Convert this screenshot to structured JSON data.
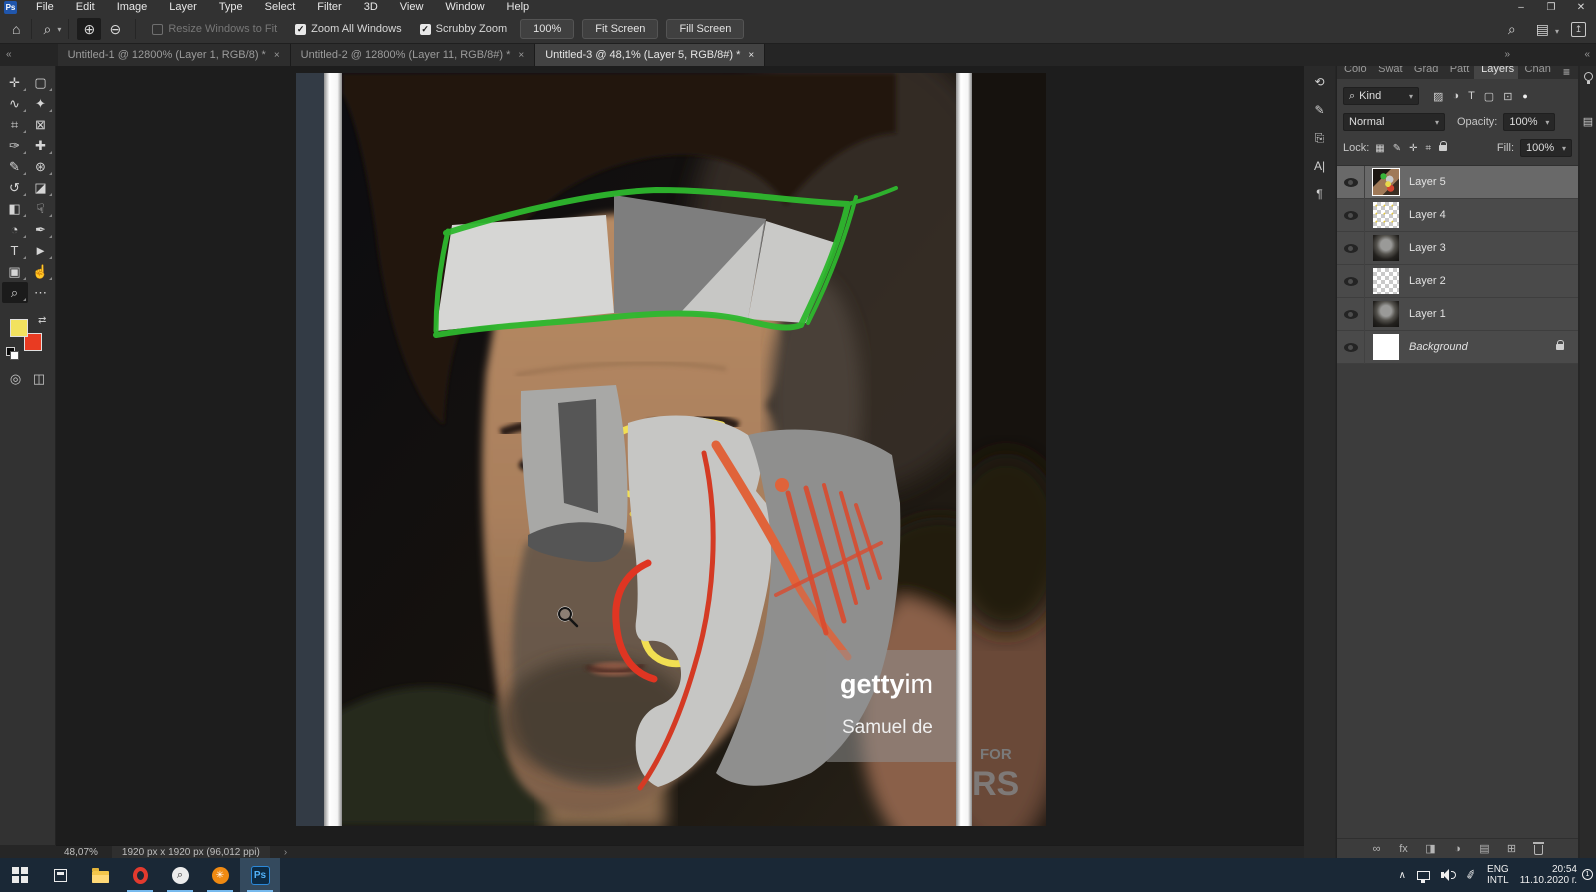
{
  "app": {
    "logo": "Ps",
    "window_controls": {
      "minimize": "–",
      "restore": "❐",
      "close": "✕"
    }
  },
  "menu_bar": {
    "items": [
      "File",
      "Edit",
      "Image",
      "Layer",
      "Type",
      "Select",
      "Filter",
      "3D",
      "View",
      "Window",
      "Help"
    ]
  },
  "options_bar": {
    "home_icon": "⌂",
    "tool_icon": "⌕",
    "caret": "▾",
    "zoom_in_icon": "⊕",
    "zoom_out_icon": "⊖",
    "check": "✓",
    "resize_label": "Resize Windows to Fit",
    "zoom_all_label": "Zoom All Windows",
    "scrubby_label": "Scrubby Zoom",
    "zoom_value": "100%",
    "fit_screen": "Fit Screen",
    "fill_screen": "Fill Screen",
    "search_icon": "⌕",
    "workspace_icon": "▤",
    "share_icon": "↥"
  },
  "tab_strip": {
    "collapse_left": "«",
    "collapse_right": "»",
    "collapse_far": "«",
    "close": "×",
    "tabs": [
      {
        "label": "Untitled-1 @ 12800% (Layer 1, RGB/8) *",
        "cls": ""
      },
      {
        "label": "Untitled-2 @ 12800% (Layer 11, RGB/8#) *",
        "cls": ""
      },
      {
        "label": "Untitled-3 @ 48,1% (Layer 5, RGB/8#) *",
        "cls": "active"
      }
    ]
  },
  "toolbar": {
    "swap_icon": "⇄",
    "quick_mask_icon": "◎",
    "screen_mode_icon": "◫",
    "tools": [
      {
        "glyph": "✛",
        "dn": "tool-move",
        "cls": "fly"
      },
      {
        "glyph": "▢",
        "dn": "tool-marquee",
        "cls": "fly"
      },
      {
        "glyph": "∿",
        "dn": "tool-lasso",
        "cls": "fly"
      },
      {
        "glyph": "✦",
        "dn": "tool-object-selection",
        "cls": "fly"
      },
      {
        "glyph": "⌗",
        "dn": "tool-crop",
        "cls": "fly"
      },
      {
        "glyph": "⊠",
        "dn": "tool-frame",
        "cls": ""
      },
      {
        "glyph": "✑",
        "dn": "tool-eyedropper",
        "cls": "fly"
      },
      {
        "glyph": "✚",
        "dn": "tool-healing-brush",
        "cls": "fly"
      },
      {
        "glyph": "✎",
        "dn": "tool-brush",
        "cls": "fly"
      },
      {
        "glyph": "⊛",
        "dn": "tool-clone-stamp",
        "cls": "fly"
      },
      {
        "glyph": "↺",
        "dn": "tool-history-brush",
        "cls": "fly"
      },
      {
        "glyph": "◪",
        "dn": "tool-eraser",
        "cls": "fly"
      },
      {
        "glyph": "◧",
        "dn": "tool-gradient",
        "cls": "fly"
      },
      {
        "glyph": "☟",
        "dn": "tool-smudge",
        "cls": "fly"
      },
      {
        "glyph": "◔",
        "dn": "tool-dodge",
        "cls": "fly"
      },
      {
        "glyph": "✒",
        "dn": "tool-pen",
        "cls": "fly"
      },
      {
        "glyph": "T",
        "dn": "tool-type",
        "cls": "fly"
      },
      {
        "glyph": "►",
        "dn": "tool-path-selection",
        "cls": "fly"
      },
      {
        "glyph": "▣",
        "dn": "tool-shape",
        "cls": "fly"
      },
      {
        "glyph": "☝",
        "dn": "tool-hand",
        "cls": "fly"
      },
      {
        "glyph": "⌕",
        "dn": "tool-zoom",
        "cls": "active fly"
      },
      {
        "glyph": "⋯",
        "dn": "tool-more",
        "cls": ""
      }
    ]
  },
  "left_dock": {
    "icons": [
      {
        "glyph": "⟲",
        "dn": "history-panel-icon"
      },
      {
        "glyph": "✎",
        "dn": "brush-settings-panel-icon"
      },
      {
        "glyph": "⎘",
        "dn": "clone-source-panel-icon"
      },
      {
        "glyph": "A|",
        "dn": "character-panel-icon"
      },
      {
        "glyph": "¶",
        "dn": "paragraph-panel-icon"
      }
    ]
  },
  "layers_panel": {
    "tabs": [
      {
        "label": "Colo",
        "cls": ""
      },
      {
        "label": "Swat",
        "cls": ""
      },
      {
        "label": "Grad",
        "cls": ""
      },
      {
        "label": "Patt",
        "cls": ""
      },
      {
        "label": "Layers",
        "cls": "active"
      },
      {
        "label": "Chan",
        "cls": ""
      }
    ],
    "menu_icon": "≡",
    "search_icon": "⌕",
    "kind": "Kind",
    "caret": "▾",
    "filter_icons": [
      {
        "glyph": "▨",
        "dn": "filter-pixel-layers-icon"
      },
      {
        "glyph": "◑",
        "dn": "filter-adjustment-layers-icon"
      },
      {
        "glyph": "T",
        "dn": "filter-type-layers-icon"
      },
      {
        "glyph": "▢",
        "dn": "filter-shape-layers-icon"
      },
      {
        "glyph": "⊡",
        "dn": "filter-smart-objects-icon"
      }
    ],
    "filter_toggle_icon": "●",
    "blend_mode": "Normal",
    "opacity_label": "Opacity:",
    "opacity_value": "100%",
    "lock_label": "Lock:",
    "lock_icons": [
      {
        "glyph": "▦",
        "dn": "lock-transparency-icon"
      },
      {
        "glyph": "✎",
        "dn": "lock-paint-icon"
      },
      {
        "glyph": "✛",
        "dn": "lock-position-icon"
      },
      {
        "glyph": "⌗",
        "dn": "lock-artboard-icon"
      }
    ],
    "fill_label": "Fill:",
    "fill_value": "100%",
    "layers": [
      {
        "name": "Layer 5",
        "cls": "sel",
        "thumbCls": "t-paint",
        "dn": "layer-row-layer-5"
      },
      {
        "name": "Layer 4",
        "cls": "",
        "thumbCls": "t-check t-mark",
        "dn": "layer-row-layer-4"
      },
      {
        "name": "Layer 3",
        "cls": "",
        "thumbCls": "t-dark",
        "dn": "layer-row-layer-3"
      },
      {
        "name": "Layer 2",
        "cls": "",
        "thumbCls": "t-check",
        "dn": "layer-row-layer-2"
      },
      {
        "name": "Layer 1",
        "cls": "",
        "thumbCls": "t-dark",
        "dn": "layer-row-layer-1"
      },
      {
        "name": "Background",
        "cls": "locked",
        "thumbCls": "t-white",
        "dn": "layer-row-background"
      }
    ],
    "bottom_icons": [
      {
        "glyph": "∞",
        "dn": "link-layers-icon",
        "cls": ""
      },
      {
        "glyph": "fx",
        "dn": "layer-style-icon",
        "cls": ""
      },
      {
        "glyph": "◨",
        "dn": "layer-mask-icon",
        "cls": ""
      },
      {
        "glyph": "◑",
        "dn": "adjustment-layer-icon",
        "cls": ""
      },
      {
        "glyph": "▤",
        "dn": "new-group-icon",
        "cls": ""
      },
      {
        "glyph": "⊞",
        "dn": "new-layer-icon",
        "cls": ""
      },
      {
        "glyph": "",
        "dn": "delete-layer-icon",
        "cls": "icon-trash"
      }
    ]
  },
  "right_dock": {
    "libraries_icon": "▤"
  },
  "status_bar": {
    "zoom": "48,07%",
    "doc_info": "1920 px x 1920 px (96,012 ppi)",
    "chevron": "›"
  },
  "canvas": {
    "watermark_brand_bold": "getty",
    "watermark_brand_rest": "im",
    "watermark_credit": "Samuel de",
    "bg_text_top": "FOR",
    "bg_text_bottom": "RS"
  },
  "taskbar": {
    "ps_label": "Ps",
    "lens_glyph": "⌕",
    "asterisk_glyph": "✳",
    "tray": {
      "expand_icon": "∧",
      "pen_icon": "✐",
      "lang_top": "ENG",
      "lang_bottom": "INTL",
      "time": "20:54",
      "date": "11.10.2020 г.",
      "badge": "1"
    }
  },
  "colors": {
    "foreground_swatch": "#f2e25f",
    "background_swatch": "#e93b22",
    "green_annotation": "#2eb82e",
    "yellow_annotation": "#f2df52",
    "red_annotation": "#e03522"
  }
}
